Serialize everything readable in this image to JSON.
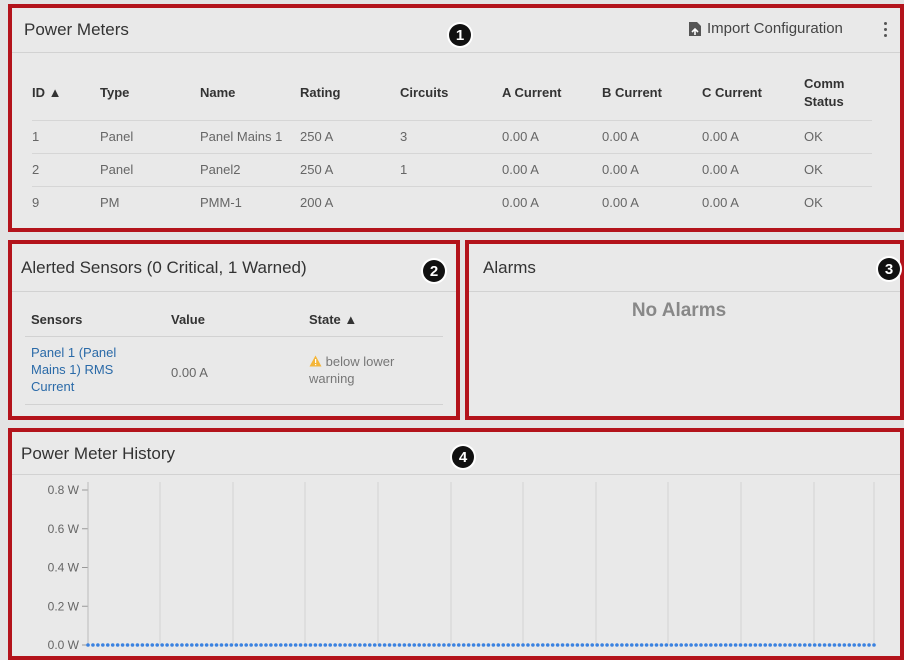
{
  "power_meters": {
    "title": "Power Meters",
    "badge": "1",
    "import_label": "Import Configuration",
    "columns": [
      "ID ▲",
      "Type",
      "Name",
      "Rating",
      "Circuits",
      "A Current",
      "B Current",
      "C Current",
      "Comm Status"
    ],
    "rows": [
      [
        "1",
        "Panel",
        "Panel Mains 1",
        "250 A",
        "3",
        "0.00 A",
        "0.00 A",
        "0.00 A",
        "OK"
      ],
      [
        "2",
        "Panel",
        "Panel2",
        "250 A",
        "1",
        "0.00 A",
        "0.00 A",
        "0.00 A",
        "OK"
      ],
      [
        "9",
        "PM",
        "PMM-1",
        "200 A",
        "",
        "0.00 A",
        "0.00 A",
        "0.00 A",
        "OK"
      ]
    ]
  },
  "alerted_sensors": {
    "title": "Alerted Sensors (0 Critical, 1 Warned)",
    "badge": "2",
    "columns": [
      "Sensors",
      "Value",
      "State ▲"
    ],
    "rows": [
      {
        "sensor": "Panel 1 (Panel Mains 1) RMS Current",
        "value": "0.00 A",
        "state": "below lower warning",
        "state_icon": "warning-icon"
      }
    ]
  },
  "alarms": {
    "title": "Alarms",
    "badge": "3",
    "empty_text": "No Alarms"
  },
  "history": {
    "title": "Power Meter History",
    "badge": "4"
  },
  "chart_data": {
    "type": "line",
    "ylim": [
      0,
      0.8
    ],
    "yticks": [
      "0.8 W",
      "0.6 W",
      "0.4 W",
      "0.2 W",
      "0.0 W"
    ],
    "series": [
      {
        "values": [
          0,
          0,
          0,
          0,
          0,
          0,
          0,
          0,
          0,
          0,
          0,
          0,
          0,
          0,
          0,
          0,
          0,
          0,
          0,
          0,
          0,
          0,
          0,
          0,
          0,
          0,
          0,
          0,
          0,
          0,
          0,
          0,
          0,
          0,
          0,
          0,
          0,
          0,
          0,
          0,
          0,
          0,
          0,
          0,
          0,
          0,
          0,
          0,
          0,
          0,
          0,
          0,
          0,
          0,
          0,
          0,
          0,
          0,
          0,
          0,
          0,
          0,
          0,
          0,
          0,
          0,
          0,
          0,
          0,
          0,
          0,
          0,
          0,
          0,
          0,
          0,
          0,
          0,
          0,
          0,
          0,
          0,
          0,
          0,
          0,
          0,
          0,
          0,
          0,
          0,
          0,
          0,
          0,
          0,
          0,
          0,
          0,
          0,
          0,
          0,
          0,
          0,
          0,
          0,
          0,
          0,
          0,
          0,
          0,
          0,
          0,
          0,
          0,
          0,
          0,
          0,
          0,
          0,
          0,
          0,
          0,
          0,
          0,
          0,
          0,
          0,
          0,
          0,
          0,
          0,
          0,
          0,
          0,
          0,
          0,
          0,
          0,
          0,
          0,
          0,
          0,
          0,
          0,
          0,
          0,
          0,
          0,
          0,
          0,
          0,
          0,
          0,
          0,
          0,
          0,
          0,
          0,
          0,
          0,
          0
        ]
      }
    ],
    "grid": true,
    "color": "#3b82e0"
  }
}
